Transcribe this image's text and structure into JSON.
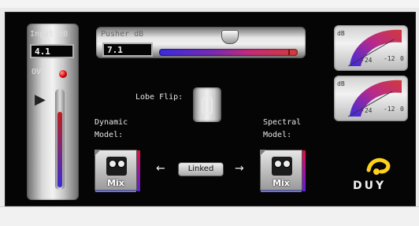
{
  "input": {
    "label": "Input  dB",
    "value": "4.1",
    "ov_label": "OV"
  },
  "pusher": {
    "label": "Pusher  dB",
    "value": "7.1",
    "level": 0.6
  },
  "meters": {
    "top": {
      "db_label": "dB",
      "ticks": [
        "-24",
        "-12",
        "0"
      ]
    },
    "bottom": {
      "db_label": "dB",
      "ticks": [
        "-24",
        "-12",
        "0"
      ]
    }
  },
  "lobe_flip": {
    "label": "Lobe Flip:"
  },
  "dynamic_model": {
    "label_line1": "Dynamic",
    "label_line2": "Model:",
    "tile_text": "Mix"
  },
  "spectral_model": {
    "label_line1": "Spectral",
    "label_line2": "Model:",
    "tile_text": "Mix"
  },
  "linked": {
    "label": "Linked"
  },
  "logo": {
    "text": "DUY"
  },
  "colors": {
    "accent_red": "#d23a3a",
    "accent_blue": "#3a2ae0",
    "gold": "#ffd21a"
  }
}
